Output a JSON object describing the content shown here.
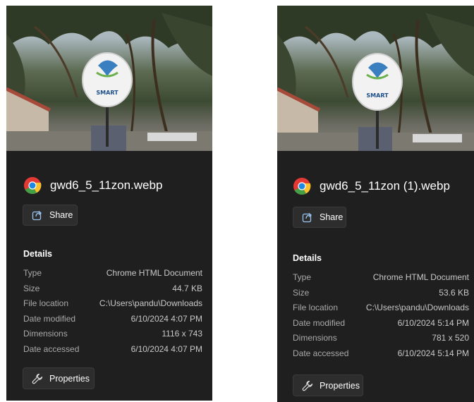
{
  "left": {
    "file_name": "gwd6_5_11zon.webp",
    "share_label": "Share",
    "details_title": "Details",
    "details": [
      {
        "label": "Type",
        "value": "Chrome HTML Document"
      },
      {
        "label": "Size",
        "value": "44.7 KB"
      },
      {
        "label": "File location",
        "value": "C:\\Users\\pandu\\Downloads"
      },
      {
        "label": "Date modified",
        "value": "6/10/2024 4:07 PM"
      },
      {
        "label": "Dimensions",
        "value": "1116 x 743"
      },
      {
        "label": "Date accessed",
        "value": "6/10/2024 4:07 PM"
      }
    ],
    "properties_label": "Properties"
  },
  "right": {
    "file_name": "gwd6_5_11zon (1).webp",
    "share_label": "Share",
    "details_title": "Details",
    "details": [
      {
        "label": "Type",
        "value": "Chrome HTML Document"
      },
      {
        "label": "Size",
        "value": "53.6 KB"
      },
      {
        "label": "File location",
        "value": "C:\\Users\\pandu\\Downloads"
      },
      {
        "label": "Date modified",
        "value": "6/10/2024 5:14 PM"
      },
      {
        "label": "Dimensions",
        "value": "781 x 520"
      },
      {
        "label": "Date accessed",
        "value": "6/10/2024 5:14 PM"
      }
    ],
    "properties_label": "Properties"
  },
  "preview_sign_text": "SMART",
  "icons": {
    "file_type": "chrome-icon",
    "share": "share-icon",
    "properties": "wrench-icon"
  },
  "colors": {
    "panel_bg": "#1f1f1f",
    "button_bg": "#2d2d2d",
    "label_text": "#a9a9a9",
    "value_text": "#c8c8c8"
  }
}
